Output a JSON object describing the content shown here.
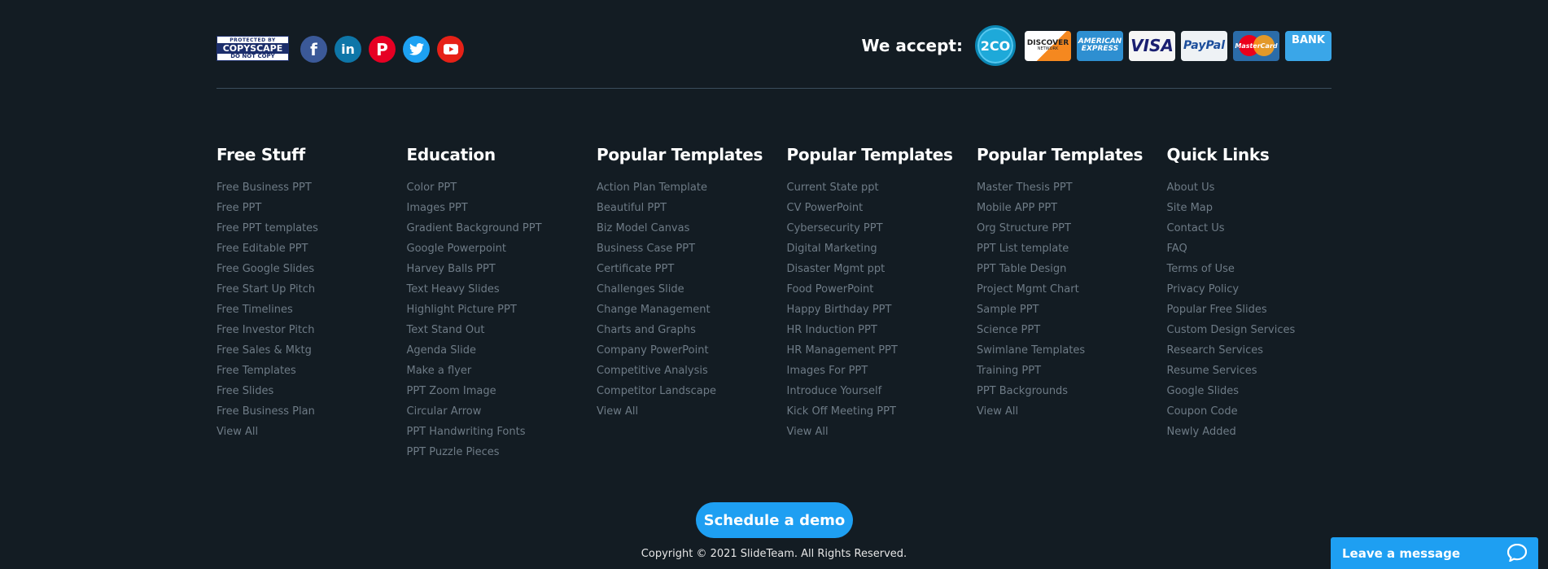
{
  "top": {
    "copyscape": {
      "line1": "PROTECTED BY",
      "line2": "COPYSCAPE",
      "line3": "DO NOT COPY"
    },
    "socials": [
      {
        "name": "facebook-icon",
        "glyph": "f"
      },
      {
        "name": "linkedin-icon",
        "glyph": "in"
      },
      {
        "name": "pinterest-icon",
        "glyph": "P"
      },
      {
        "name": "twitter-icon",
        "glyph": ""
      },
      {
        "name": "youtube-icon",
        "glyph": ""
      }
    ],
    "accept_label": "We accept:",
    "cards": {
      "c2co": "2CO",
      "discover": "DISCOVER",
      "discover_sub": "NETWORK",
      "amex1": "AMERICAN",
      "amex2": "EXPRESS",
      "visa": "VISA",
      "paypal": "PayPal",
      "mastercard": "MasterCard",
      "bank": "BANK"
    }
  },
  "columns": [
    {
      "title": "Free Stuff",
      "links": [
        "Free Business PPT",
        "Free PPT",
        "Free PPT templates",
        "Free Editable PPT",
        "Free Google Slides",
        "Free Start Up Pitch",
        "Free Timelines",
        "Free Investor Pitch",
        "Free Sales & Mktg",
        "Free Templates",
        "Free Slides",
        "Free Business Plan",
        "View All"
      ]
    },
    {
      "title": "Education",
      "links": [
        "Color PPT",
        "Images PPT",
        "Gradient Background PPT",
        "Google Powerpoint",
        "Harvey Balls PPT",
        "Text Heavy Slides",
        "Highlight Picture PPT",
        "Text Stand Out",
        "Agenda Slide",
        "Make a flyer",
        "PPT Zoom Image",
        "Circular Arrow",
        "PPT Handwriting Fonts",
        "PPT Puzzle Pieces"
      ]
    },
    {
      "title": "Popular Templates",
      "links": [
        "Action Plan Template",
        "Beautiful PPT",
        "Biz Model Canvas",
        "Business Case PPT",
        "Certificate PPT",
        "Challenges Slide",
        "Change Management",
        "Charts and Graphs",
        "Company PowerPoint",
        "Competitive Analysis",
        "Competitor Landscape",
        "View All"
      ]
    },
    {
      "title": "Popular Templates",
      "links": [
        "Current State ppt",
        "CV PowerPoint",
        "Cybersecurity PPT",
        "Digital Marketing",
        "Disaster Mgmt ppt",
        "Food PowerPoint",
        "Happy Birthday PPT",
        "HR Induction PPT",
        "HR Management PPT",
        "Images For PPT",
        "Introduce Yourself",
        "Kick Off Meeting PPT",
        "View All"
      ]
    },
    {
      "title": "Popular Templates",
      "links": [
        "Master Thesis PPT",
        "Mobile APP PPT",
        "Org Structure PPT",
        "PPT List template",
        "PPT Table Design",
        "Project Mgmt Chart",
        "Sample PPT",
        "Science PPT",
        "Swimlane Templates",
        "Training PPT",
        "PPT Backgrounds",
        "View All"
      ]
    },
    {
      "title": "Quick Links",
      "links": [
        "About Us",
        "Site Map",
        "Contact Us",
        "FAQ",
        "Terms of Use",
        "Privacy Policy",
        "Popular Free Slides",
        "Custom Design Services",
        "Research Services",
        "Resume Services",
        "Google Slides",
        "Coupon Code",
        "Newly Added"
      ]
    }
  ],
  "demo_button": "Schedule a demo",
  "copyright": "Copyright © 2021 SlideTeam. All Rights Reserved.",
  "chat_label": "Leave a message"
}
